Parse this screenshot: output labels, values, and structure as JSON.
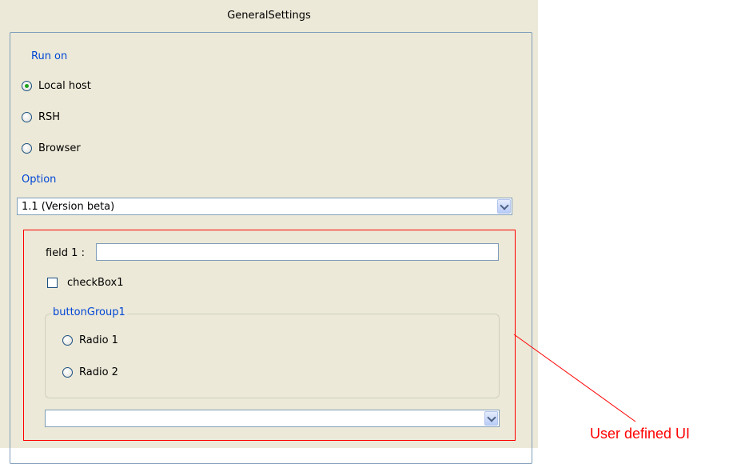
{
  "panel": {
    "title": "GeneralSettings",
    "run_on": {
      "label": "Run on",
      "options": [
        {
          "label": "Local host",
          "checked": true
        },
        {
          "label": "RSH",
          "checked": false
        },
        {
          "label": "Browser",
          "checked": false
        }
      ]
    },
    "option": {
      "label": "Option",
      "selected": "1.1 (Version beta)"
    },
    "user_ui": {
      "field1_label": "field 1 :",
      "field1_value": "",
      "checkbox_label": "checkBox1",
      "checkbox_checked": false,
      "button_group": {
        "title": "buttonGroup1",
        "radios": [
          {
            "label": "Radio 1",
            "checked": false
          },
          {
            "label": "Radio 2",
            "checked": false
          }
        ]
      },
      "bottom_combo_value": ""
    }
  },
  "annotation": {
    "text": "User defined UI",
    "color": "#ff0000"
  },
  "colors": {
    "panel_bg": "#ece9d8",
    "label_blue": "#0046d5",
    "border_blue": "#7f9db9",
    "highlight_red": "#ff0000"
  },
  "icons": {
    "dropdown": "chevron-down-icon"
  }
}
